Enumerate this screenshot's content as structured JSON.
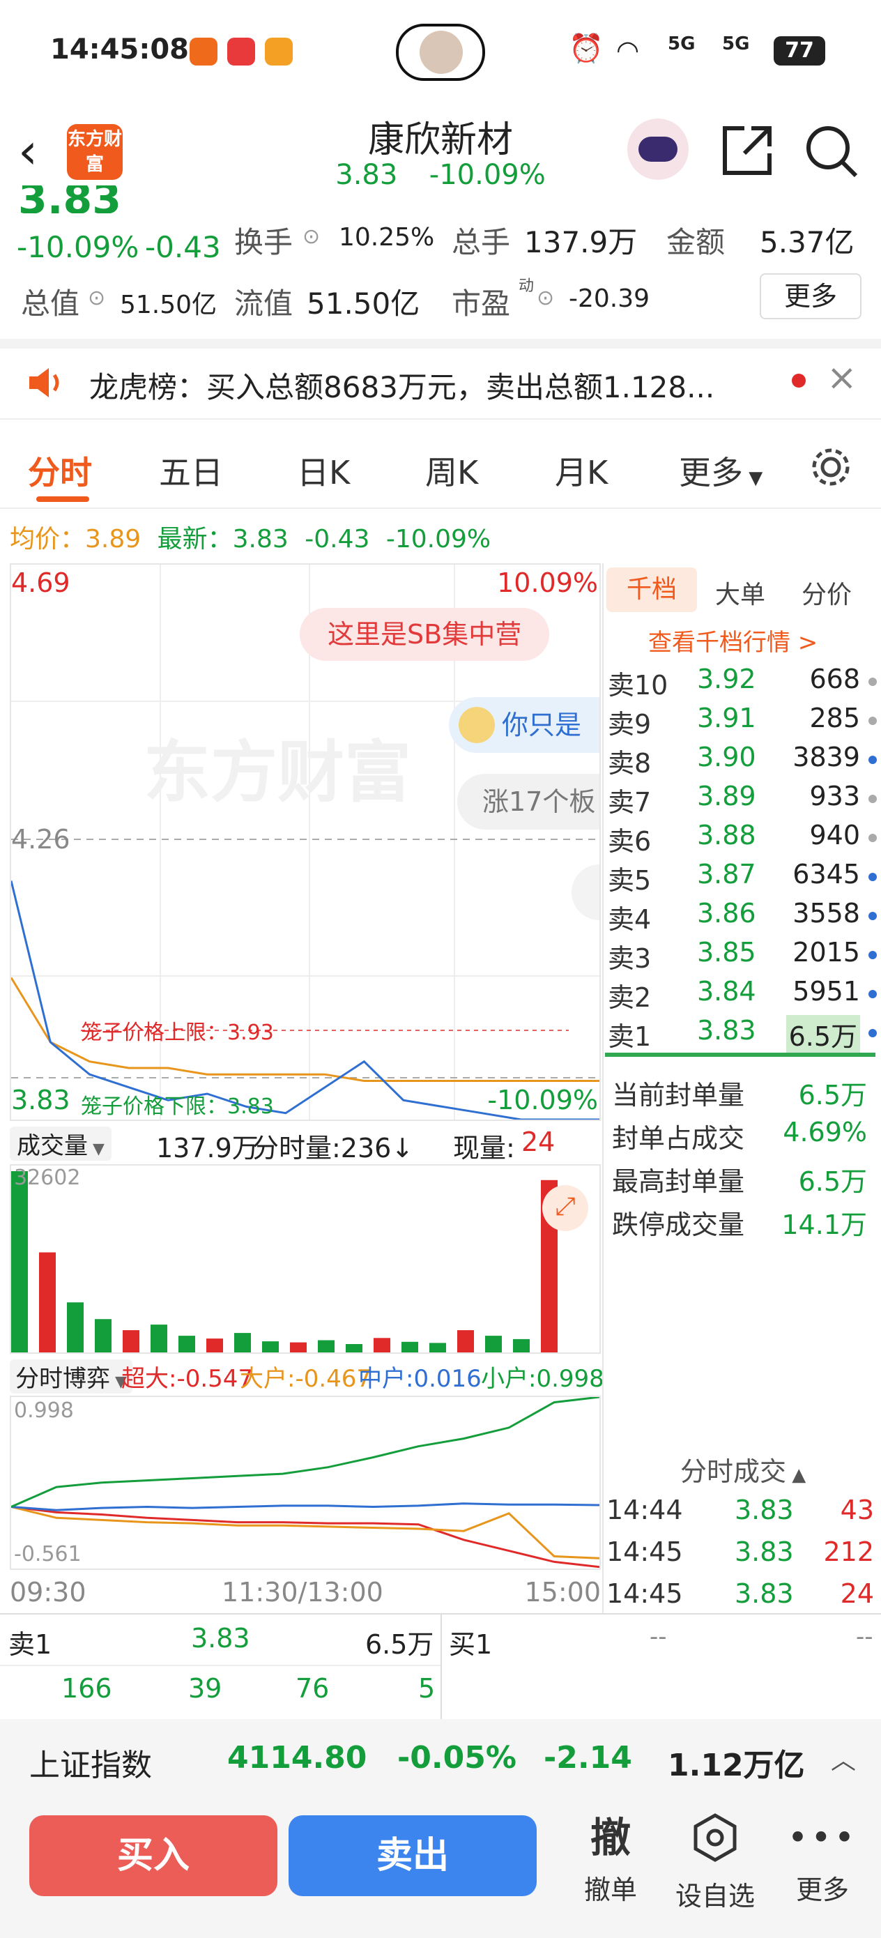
{
  "status": {
    "time": "14:45:08",
    "network1": "5G",
    "network2": "5G",
    "battery": "77"
  },
  "nav": {
    "logo_text": "东方财富",
    "stock_name": "康欣新材",
    "price": "3.83",
    "change_pct": "-10.09%"
  },
  "quote": {
    "big_price_partial": "3.83",
    "change_pct": "-10.09%",
    "change_abs": "-0.43",
    "turnover_label": "换手",
    "turnover_value": "10.25%",
    "total_vol_label": "总手",
    "total_vol_value": "137.9万",
    "amount_label": "金额",
    "amount_value": "5.37亿",
    "mktcap_label": "总值",
    "mktcap_value": "51.50亿",
    "float_label": "流值",
    "float_value": "51.50亿",
    "pe_label": "市盈",
    "pe_sup": "动",
    "pe_value": "-20.39",
    "more_button": "更多"
  },
  "notice": {
    "text": "龙虎榜：买入总额8683万元，卖出总额1.128..."
  },
  "tabs": [
    "分时",
    "五日",
    "日K",
    "周K",
    "月K",
    "更多"
  ],
  "avg_line": {
    "avg_label": "均价：",
    "avg_value": "3.89",
    "latest_label": "最新：",
    "latest_value": "3.83",
    "change_abs": "-0.43",
    "change_pct": "-10.09%"
  },
  "price_chart": {
    "top_price": "4.69",
    "top_pct": "10.09%",
    "mid_price": "4.26",
    "bottom_price": "3.83",
    "bottom_pct": "-10.09%",
    "bubble1": "这里是SB集中营",
    "bubble2": "你只是",
    "bubble3": "涨17个板",
    "cage_upper": "笼子价格上限：3.93",
    "cage_lower": "笼子价格下限：3.83",
    "watermark": "东方财富"
  },
  "volume_bar": {
    "label": "成交量",
    "total": "137.9万",
    "tick_label": "分时量:236↓",
    "now_label": "现量:",
    "now_value": "24",
    "max_value": "32602"
  },
  "flow_bar": {
    "label": "分时博弈",
    "super_label": "超大:",
    "super_value": "-0.547",
    "big_label": "大户:",
    "big_value": "-0.467",
    "mid_label": "中户:",
    "mid_value": "0.016",
    "small_label": "小户:",
    "small_value": "0.998",
    "top_value": "0.998",
    "bottom_value": "-0.561"
  },
  "time_axis": [
    "09:30",
    "11:30/13:00",
    "15:00"
  ],
  "order_book": {
    "tabs": [
      "千档",
      "大单",
      "分价"
    ],
    "view_link": "查看千档行情 >",
    "asks": [
      {
        "label": "卖10",
        "price": "3.92",
        "vol": "668",
        "dot": "#aaa"
      },
      {
        "label": "卖9",
        "price": "3.91",
        "vol": "285",
        "dot": "#aaa"
      },
      {
        "label": "卖8",
        "price": "3.90",
        "vol": "3839",
        "dot": "#2f6fd1"
      },
      {
        "label": "卖7",
        "price": "3.89",
        "vol": "933",
        "dot": "#aaa"
      },
      {
        "label": "卖6",
        "price": "3.88",
        "vol": "940",
        "dot": "#aaa"
      },
      {
        "label": "卖5",
        "price": "3.87",
        "vol": "6345",
        "dot": "#2f6fd1"
      },
      {
        "label": "卖4",
        "price": "3.86",
        "vol": "3558",
        "dot": "#2f6fd1"
      },
      {
        "label": "卖3",
        "price": "3.85",
        "vol": "2015",
        "dot": "#2f6fd1"
      },
      {
        "label": "卖2",
        "price": "3.84",
        "vol": "5951",
        "dot": "#2f6fd1"
      },
      {
        "label": "卖1",
        "price": "3.83",
        "vol": "6.5万",
        "dot": "#2f6fd1"
      }
    ]
  },
  "seal_stats": [
    {
      "label": "当前封单量",
      "value": "6.5万"
    },
    {
      "label": "封单占成交",
      "value": "4.69%"
    },
    {
      "label": "最高封单量",
      "value": "6.5万"
    },
    {
      "label": "跌停成交量",
      "value": "14.1万"
    }
  ],
  "trades": {
    "title": "分时成交",
    "rows": [
      {
        "time": "14:44",
        "price": "3.83",
        "vol": "43"
      },
      {
        "time": "14:45",
        "price": "3.83",
        "vol": "212"
      },
      {
        "time": "14:45",
        "price": "3.83",
        "vol": "24"
      }
    ]
  },
  "level1": {
    "sell_label": "卖1",
    "sell_price": "3.83",
    "sell_vol": "6.5万",
    "buy_label": "买1",
    "buy_price": "--",
    "buy_vol": "--",
    "queue": [
      "166",
      "39",
      "76",
      "5"
    ]
  },
  "index_bar": {
    "name": "上证指数",
    "value": "4114.80",
    "pct": "-0.05%",
    "abs": "-2.14",
    "amount": "1.12万亿"
  },
  "actions": {
    "buy": "买入",
    "sell": "卖出",
    "cancel_icon_char": "撤",
    "cancel": "撤单",
    "watch": "设自选",
    "more": "更多"
  },
  "colors": {
    "red": "#e02a2a",
    "green": "#139e3b",
    "orange": "#e8951c",
    "blue": "#2f6fd1"
  },
  "chart_data": [
    {
      "type": "line",
      "title": "",
      "x": [
        "09:30",
        "11:30/13:00",
        "15:00"
      ],
      "series": [
        {
          "values": [
            4.2,
            3.95,
            3.9,
            3.88,
            3.86,
            3.87,
            3.85,
            3.84,
            3.88,
            3.92,
            3.86,
            3.85,
            3.84,
            3.83,
            3.83,
            3.83
          ]
        },
        {
          "values": [
            4.05,
            3.95,
            3.92,
            3.91,
            3.91,
            3.9,
            3.9,
            3.9,
            3.9,
            3.89,
            3.89,
            3.89,
            3.89,
            3.89,
            3.89,
            3.89
          ]
        }
      ],
      "ylim": [
        3.83,
        4.69
      ]
    },
    {
      "type": "bar",
      "title": "",
      "values": [
        32602,
        18000,
        9000,
        6000,
        4000,
        5000,
        3000,
        2500,
        3500,
        2000,
        1800,
        2200,
        1500,
        2600,
        1900,
        1700,
        4000,
        3000,
        2400,
        31000
      ],
      "ylim": [
        0,
        32602
      ]
    },
    {
      "type": "line",
      "title": "",
      "series": [
        {
          "name": "超大",
          "values": [
            0.0,
            -0.05,
            -0.07,
            -0.1,
            -0.12,
            -0.14,
            -0.14,
            -0.15,
            -0.15,
            -0.16,
            -0.3,
            -0.4,
            -0.5,
            -0.547
          ]
        },
        {
          "name": "大户",
          "values": [
            0.0,
            -0.1,
            -0.12,
            -0.14,
            -0.15,
            -0.17,
            -0.17,
            -0.18,
            -0.19,
            -0.2,
            -0.22,
            -0.06,
            -0.45,
            -0.467
          ]
        },
        {
          "name": "中户",
          "values": [
            0.0,
            -0.03,
            -0.01,
            0.0,
            -0.01,
            0.0,
            0.01,
            0.01,
            0.0,
            0.01,
            0.03,
            0.02,
            0.02,
            0.016
          ]
        },
        {
          "name": "小户",
          "values": [
            0.0,
            0.18,
            0.22,
            0.24,
            0.26,
            0.28,
            0.3,
            0.36,
            0.45,
            0.55,
            0.62,
            0.72,
            0.95,
            0.998
          ]
        }
      ],
      "ylim": [
        -0.561,
        0.998
      ]
    }
  ]
}
